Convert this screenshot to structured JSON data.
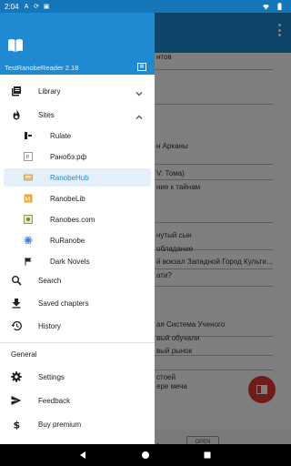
{
  "status_bar": {
    "time": "2:04",
    "icons": [
      "a-icon",
      "sync-icon",
      "screenshot-icon",
      "wifi-icon",
      "battery-icon"
    ]
  },
  "background": {
    "lines": [
      "нтов",
      "н Арканы",
      "V: Тома)",
      "ние к тайнам",
      "нутый сын",
      "обладание",
      "й вокзал Западной Город Культи...",
      "ати?",
      "ая Система Ученого",
      "вый обучали",
      "вый рынок",
      "стоей",
      "ере меча",
      "tes."
    ],
    "ad_button": "OPEN",
    "fab_color": "#e53935"
  },
  "drawer": {
    "app_name": "TestRanobeReader 2.18",
    "header_color": "#1f8ad1",
    "nav": {
      "library": "Library",
      "sites": "Sites",
      "search": "Search",
      "saved": "Saved chapters",
      "history": "History"
    },
    "sites": [
      {
        "label": "Rulate",
        "icon": "rulate-icon"
      },
      {
        "label": "Ранобэ.рф",
        "icon": "ranobe-rf-icon"
      },
      {
        "label": "RanobeHub",
        "icon": "ranobehub-icon",
        "selected": true
      },
      {
        "label": "RanobeLib",
        "icon": "ranobelib-icon"
      },
      {
        "label": "Ranobes.com",
        "icon": "ranobes-icon"
      },
      {
        "label": "RuRanobe",
        "icon": "ruranobe-icon"
      },
      {
        "label": "Dark Novels",
        "icon": "dark-novels-icon"
      }
    ],
    "general": {
      "title": "General",
      "settings": "Settings",
      "feedback": "Feedback",
      "premium": "Buy premium"
    }
  },
  "colors": {
    "accent": "#1f8ad1",
    "selected_bg": "#e3f0fb"
  }
}
